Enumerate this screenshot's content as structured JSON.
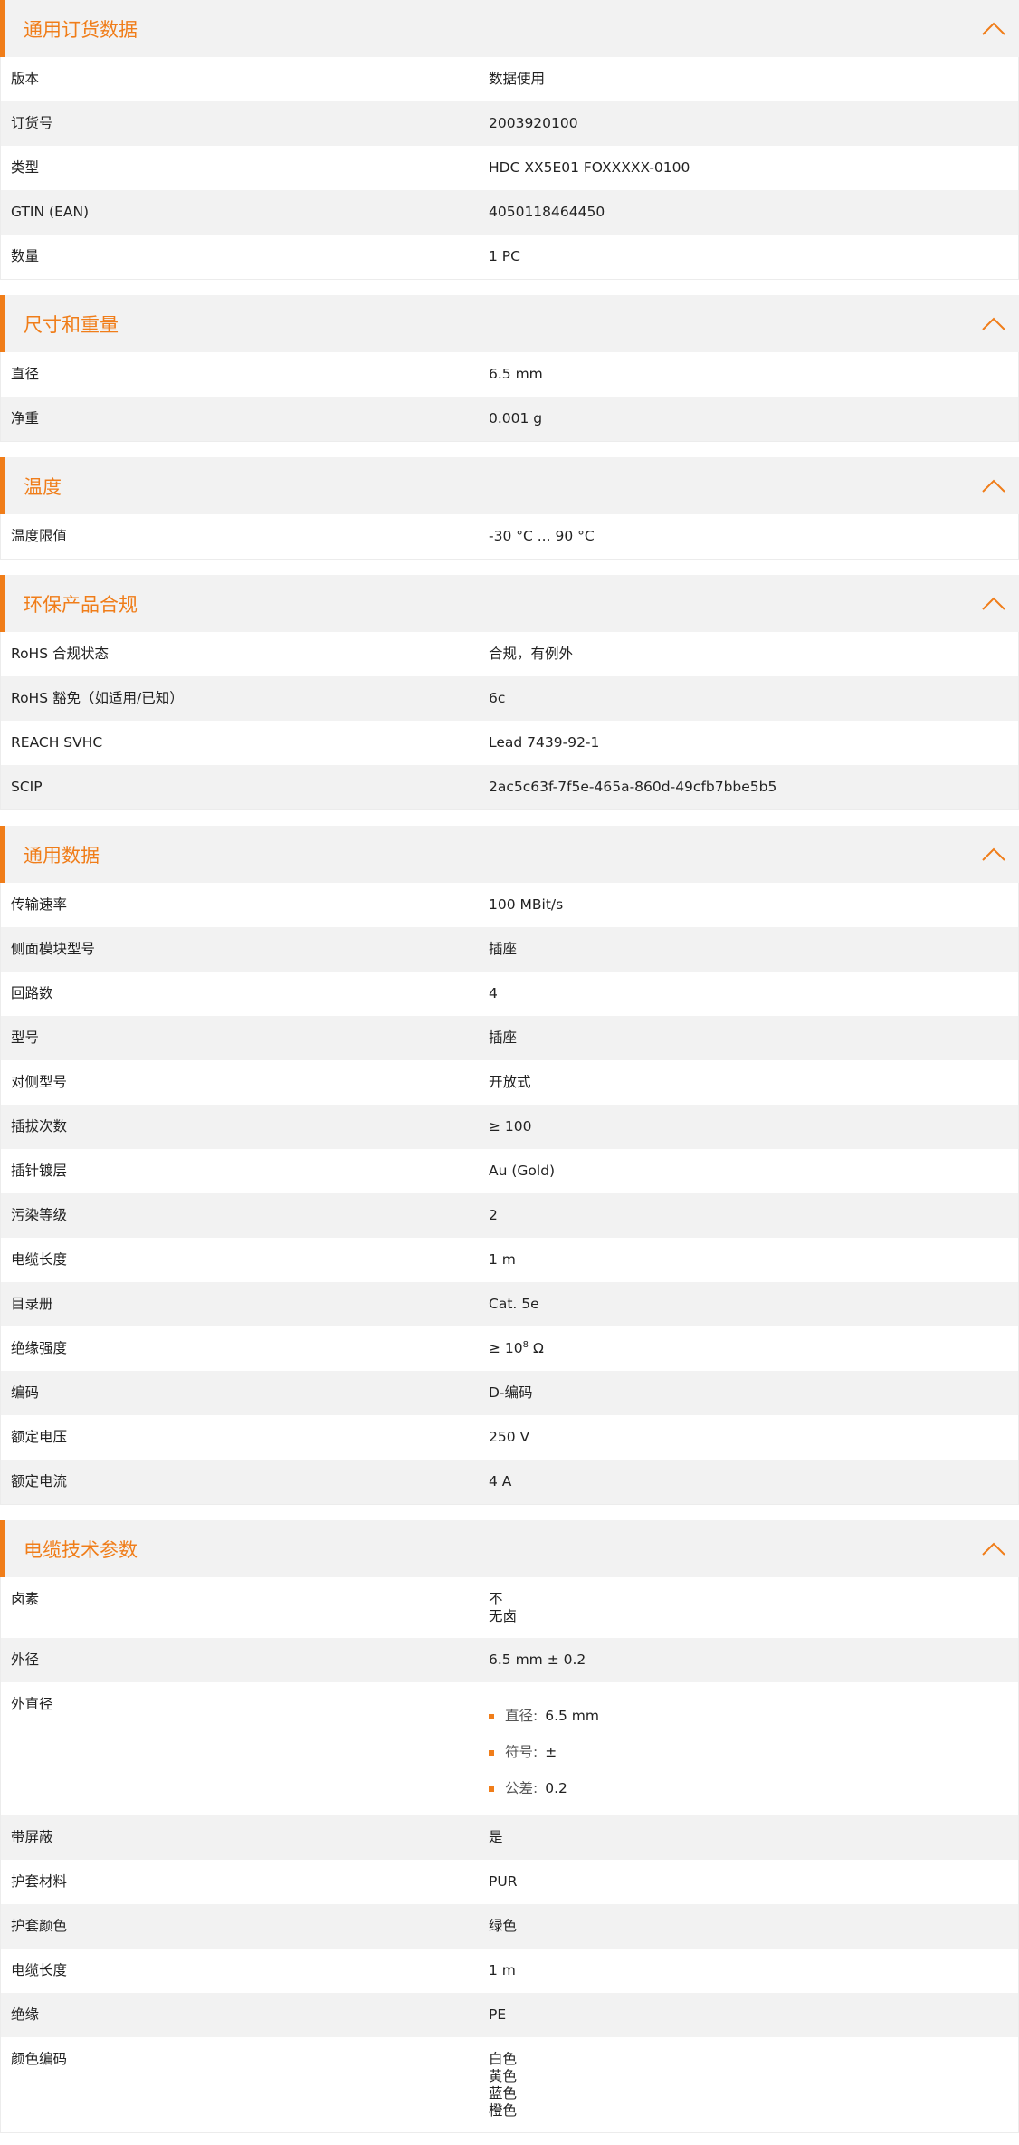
{
  "accent_color": "#f07d19",
  "sections": {
    "ordering": {
      "title": "通用订货数据",
      "rows": [
        {
          "label": "版本",
          "value": "数据使用"
        },
        {
          "label": "订货号",
          "value": "2003920100"
        },
        {
          "label": "类型",
          "value": "HDC XX5E01 FOXXXXX-0100"
        },
        {
          "label": "GTIN (EAN)",
          "value": "4050118464450"
        },
        {
          "label": "数量",
          "value": "1  PC"
        }
      ]
    },
    "dimensions": {
      "title": "尺寸和重量",
      "rows": [
        {
          "label": "直径",
          "value": "6.5  mm"
        },
        {
          "label": "净重",
          "value": "0.001  g"
        }
      ]
    },
    "temperature": {
      "title": "温度",
      "rows": [
        {
          "label": "温度限值",
          "value": "-30 °C ... 90 °C"
        }
      ]
    },
    "compliance": {
      "title": "环保产品合规",
      "rows": [
        {
          "label": "RoHS 合规状态",
          "value": "合规，有例外"
        },
        {
          "label": "RoHS 豁免（如适用/已知）",
          "value": "6c"
        },
        {
          "label": "REACH SVHC",
          "value": "Lead 7439-92-1"
        },
        {
          "label": "SCIP",
          "value": "2ac5c63f-7f5e-465a-860d-49cfb7bbe5b5"
        }
      ]
    },
    "general": {
      "title": "通用数据",
      "rows": [
        {
          "label": "传输速率",
          "value": "100 MBit/s"
        },
        {
          "label": "侧面模块型号",
          "value": "插座"
        },
        {
          "label": "回路数",
          "value": "4"
        },
        {
          "label": "型号",
          "value": "插座"
        },
        {
          "label": "对侧型号",
          "value": "开放式"
        },
        {
          "label": "插拔次数",
          "value": "≥ 100"
        },
        {
          "label": "插针镀层",
          "value": "Au (Gold)"
        },
        {
          "label": "污染等级",
          "value": "2"
        },
        {
          "label": "电缆长度",
          "value": "1  m"
        },
        {
          "label": "目录册",
          "value": "Cat. 5e"
        },
        {
          "label": "绝缘强度",
          "value_base": "≥ 10",
          "value_exp": "8",
          "value_unit": " Ω"
        },
        {
          "label": "编码",
          "value": "D-编码"
        },
        {
          "label": "额定电压",
          "value": "250  V"
        },
        {
          "label": "额定电流",
          "value": "4  A"
        }
      ]
    },
    "cable": {
      "title": "电缆技术参数",
      "rows": [
        {
          "label": "卤素",
          "lines": [
            "不",
            "无卤"
          ]
        },
        {
          "label": "外径",
          "value": "6.5 mm ± 0.2"
        },
        {
          "label": "外直径",
          "items": [
            {
              "key": "直径:",
              "value": "6.5 mm"
            },
            {
              "key": "符号:",
              "value": "±"
            },
            {
              "key": "公差:",
              "value": "0.2"
            }
          ]
        },
        {
          "label": "带屏蔽",
          "value": "是"
        },
        {
          "label": "护套材料",
          "value": "PUR"
        },
        {
          "label": "护套颜色",
          "value": "绿色"
        },
        {
          "label": "电缆长度",
          "value": "1  m"
        },
        {
          "label": "绝缘",
          "value": "PE"
        },
        {
          "label": "颜色编码",
          "lines": [
            "白色",
            "黄色",
            "蓝色",
            "橙色"
          ]
        }
      ]
    }
  }
}
